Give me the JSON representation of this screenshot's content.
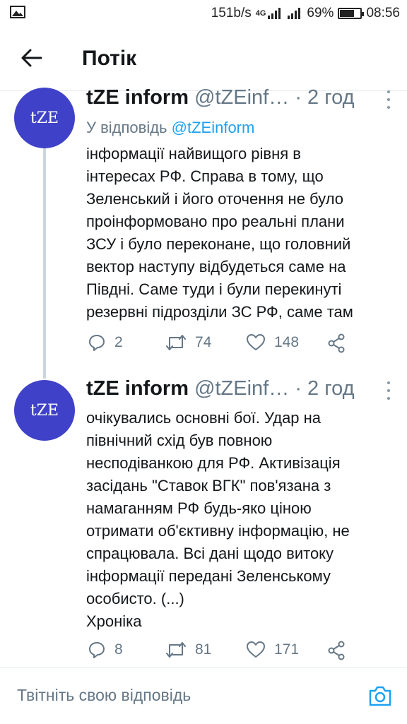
{
  "status_bar": {
    "speed": "151b/s",
    "network": "4G",
    "battery": "69%",
    "battery_level": 0.69,
    "time": "08:56"
  },
  "header": {
    "title": "Потік"
  },
  "tweets": [
    {
      "avatar_text": "tZE",
      "name": "tZE inform",
      "handle": "@tZEinf…",
      "separator": "·",
      "time": "2 год",
      "reply_prefix": "У відповідь",
      "reply_handle": "@tZEinform",
      "text": "інформації найвищого рівня в\nінтересах РФ. Справа в тому, що\nЗеленський і його оточення не було\nпроінформовано про реальні плани\nЗСУ і було переконане, що головний\nвектор наступу відбудеться саме на\nПівдні. Саме туди і були перекинуті\nрезервні підрозділи ЗС РФ, саме там",
      "replies": "2",
      "retweets": "74",
      "likes": "148"
    },
    {
      "avatar_text": "tZE",
      "name": "tZE inform",
      "handle": "@tZEinf…",
      "separator": "·",
      "time": "2 год",
      "text": "очікувались основні бої. Удар на\nпівнічний схід був повною\nнесподіванкою для РФ.  Активізація\nзасідань \"Ставок ВГК\" пов'язана з\nнамаганням РФ будь-яко ціною\nотримати об'єктивну інформацію, не\nспрацювала. Всі дані щодо витоку\nінформації передані Зеленському\nособисто. (...)\nХроніка",
      "replies": "8",
      "retweets": "81",
      "likes": "171"
    }
  ],
  "compose": {
    "placeholder": "Твітніть свою відповідь"
  },
  "icons": {
    "back": "arrow-left-icon",
    "reply": "comment-icon",
    "retweet": "retweet-icon",
    "like": "heart-icon",
    "share": "share-icon",
    "camera": "camera-icon",
    "more": "more-vertical-icon"
  },
  "colors": {
    "avatar": "#3f42c8",
    "link": "#1da1f2",
    "muted": "#657786"
  }
}
